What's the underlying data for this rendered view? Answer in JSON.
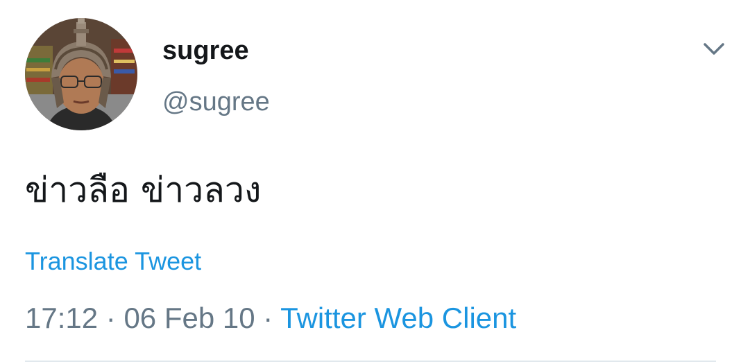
{
  "tweet": {
    "display_name": "sugree",
    "handle": "@sugree",
    "text": "ข่าวลือ ข่าวลวง",
    "translate_label": "Translate Tweet",
    "time": "17:12",
    "separator": " · ",
    "date": "06 Feb 10",
    "source": "Twitter Web Client"
  },
  "icons": {
    "caret": "chevron-down-icon",
    "avatar": "avatar-photo"
  },
  "colors": {
    "text_primary": "#14171a",
    "text_secondary": "#657786",
    "link": "#1b95e0",
    "divider": "#e1e8ed"
  }
}
